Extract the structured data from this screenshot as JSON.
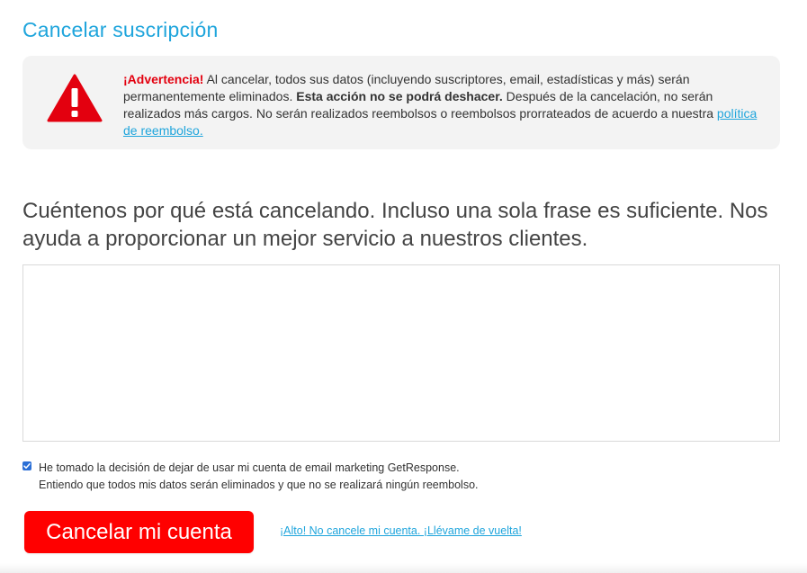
{
  "page": {
    "title": "Cancelar suscripción"
  },
  "warning": {
    "icon": "warning-triangle-icon",
    "icon_color": "#e3000f",
    "label": "¡Advertencia!",
    "text_1": " Al cancelar, todos sus datos (incluyendo suscriptores, email, estadísticas y más) serán permanentemente eliminados. ",
    "strong": "Esta acción no se podrá deshacer.",
    "text_2": " Después de la cancelación, no serán realizados más cargos. No serán realizados reembolsos o reembolsos prorrateados de acuerdo a nuestra ",
    "link": "política de reembolso."
  },
  "reason": {
    "prompt": "Cuéntenos por qué está cancelando. Incluso una sola frase es suficiente. Nos ayuda a proporcionar un mejor servicio a nuestros clientes.",
    "value": ""
  },
  "confirm": {
    "checked": true,
    "line_1": "He tomado la decisión de dejar de usar mi cuenta de email marketing GetResponse.",
    "line_2": "Entiendo que todos mis datos serán eliminados y que no se realizará ningún reembolso."
  },
  "actions": {
    "cancel_label": "Cancelar mi cuenta",
    "go_back_label": "¡Alto! No cancele mi cuenta. ¡Llévame de vuelta!"
  },
  "colors": {
    "accent": "#1fa5dc",
    "danger": "#ff0000"
  }
}
